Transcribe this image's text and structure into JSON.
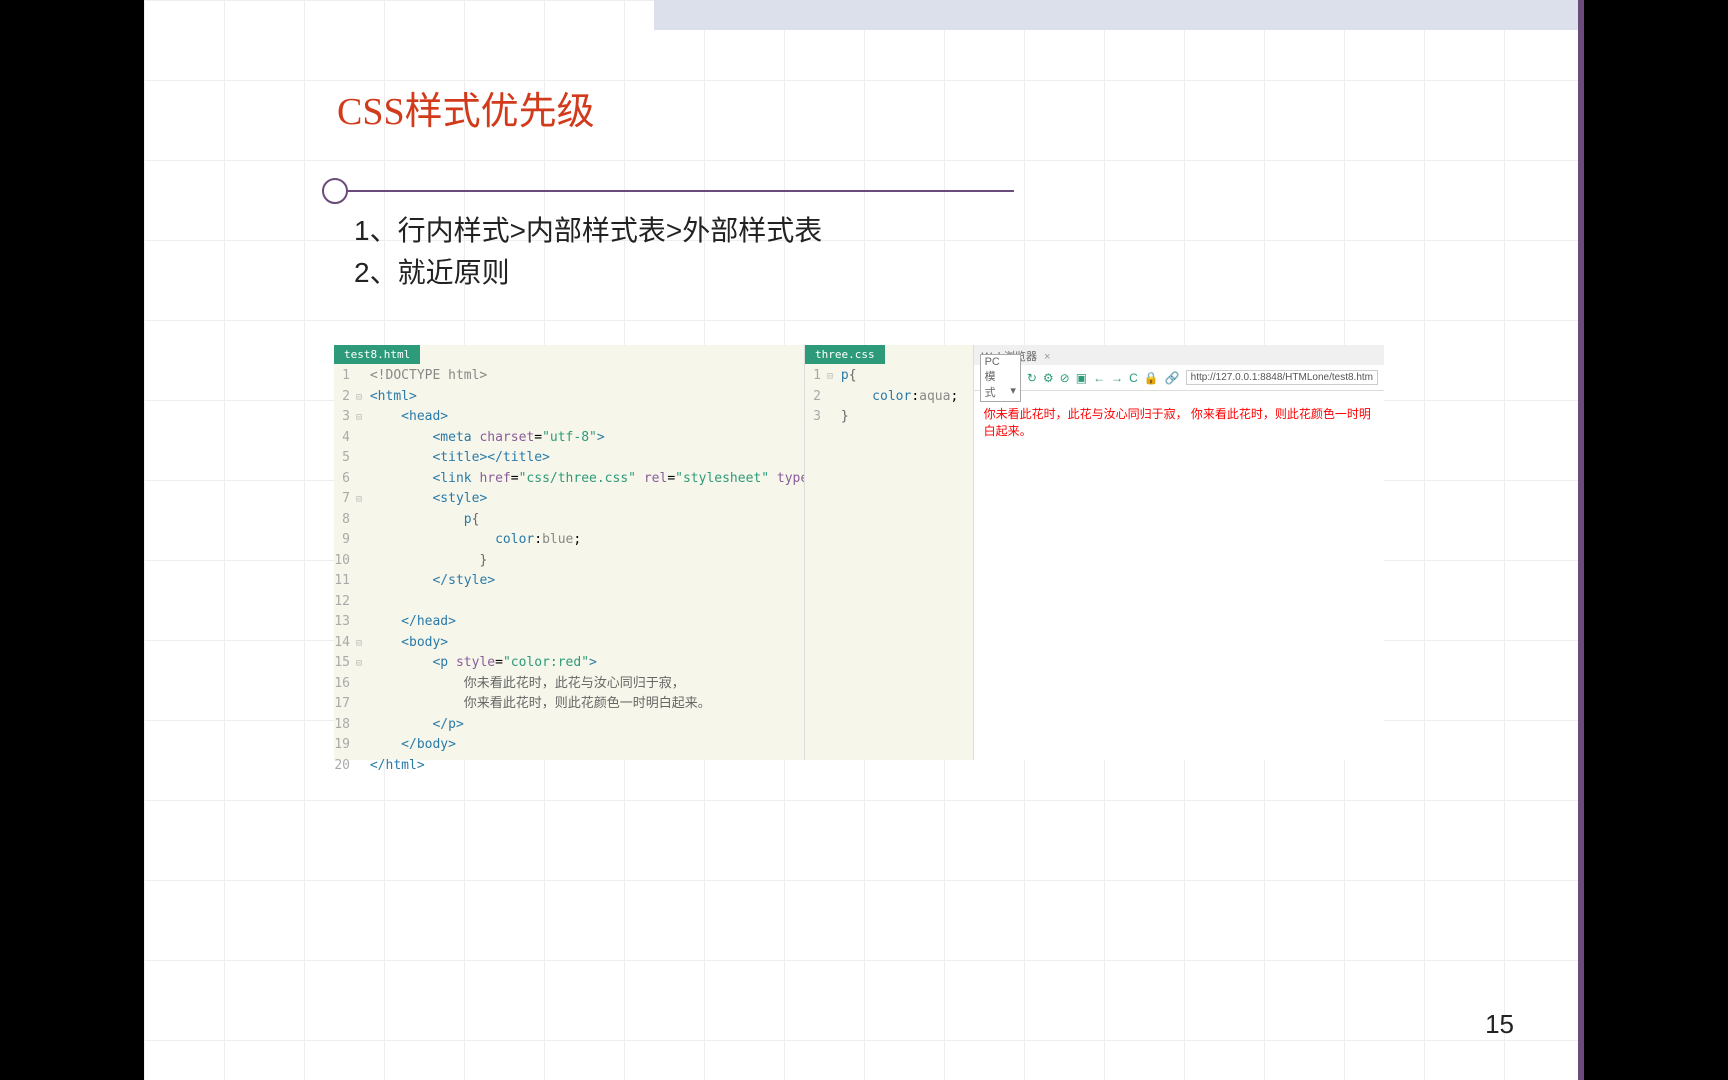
{
  "slide": {
    "title": "CSS样式优先级",
    "bullets": [
      "1、行内样式>内部样式表>外部样式表",
      "2、就近原则"
    ],
    "page_number": "15"
  },
  "editor_html": {
    "tab": "test8.html",
    "lines": [
      {
        "n": "1",
        "fold": "",
        "html": "<span class='tok-doctype'>&lt;!DOCTYPE html&gt;</span>"
      },
      {
        "n": "2",
        "fold": "⊟",
        "html": "<span class='tok-tag'>&lt;html&gt;</span>"
      },
      {
        "n": "3",
        "fold": "⊟",
        "html": "    <span class='tok-tag'>&lt;head&gt;</span>"
      },
      {
        "n": "4",
        "fold": "",
        "html": "        <span class='tok-tag'>&lt;meta</span> <span class='tok-attr-name'>charset</span>=<span class='tok-attr-val'>\"utf-8\"</span><span class='tok-tag'>&gt;</span>"
      },
      {
        "n": "5",
        "fold": "",
        "html": "        <span class='tok-tag'>&lt;title&gt;&lt;/title&gt;</span>"
      },
      {
        "n": "6",
        "fold": "",
        "html": "        <span class='tok-tag'>&lt;link</span> <span class='tok-attr-name'>href</span>=<span class='tok-attr-val'>\"css/three.css\"</span> <span class='tok-attr-name'>rel</span>=<span class='tok-attr-val'>\"stylesheet\"</span> <span class='tok-attr-name'>type</span>=<span class='tok-attr-val'>\"text/css\"</span>"
      },
      {
        "n": "7",
        "fold": "⊟",
        "html": "        <span class='tok-tag'>&lt;style&gt;</span>"
      },
      {
        "n": "8",
        "fold": "",
        "html": "            <span class='tok-tag'>p</span><span class='tok-brace'>{</span>"
      },
      {
        "n": "9",
        "fold": "",
        "html": "                <span class='tok-css-prop'>color</span>:<span class='tok-css-val'>blue</span>;"
      },
      {
        "n": "10",
        "fold": "",
        "html": "              <span class='tok-brace'>}</span>"
      },
      {
        "n": "11",
        "fold": "",
        "html": "        <span class='tok-tag'>&lt;/style&gt;</span>"
      },
      {
        "n": "12",
        "fold": "",
        "html": ""
      },
      {
        "n": "13",
        "fold": "",
        "html": "    <span class='tok-tag'>&lt;/head&gt;</span>"
      },
      {
        "n": "14",
        "fold": "⊟",
        "html": "    <span class='tok-tag'>&lt;body&gt;</span>"
      },
      {
        "n": "15",
        "fold": "⊟",
        "html": "        <span class='tok-tag'>&lt;p</span> <span class='tok-attr-name'>style</span>=<span class='tok-attr-val'>\"color:red\"</span><span class='tok-tag'>&gt;</span>"
      },
      {
        "n": "16",
        "fold": "",
        "html": "            <span class='tok-text'>你未看此花时，此花与汝心同归于寂，</span>"
      },
      {
        "n": "17",
        "fold": "",
        "html": "            <span class='tok-text'>你来看此花时，则此花颜色一时明白起来。</span>"
      },
      {
        "n": "18",
        "fold": "",
        "html": "        <span class='tok-tag'>&lt;/p&gt;</span>"
      },
      {
        "n": "19",
        "fold": "",
        "html": "    <span class='tok-tag'>&lt;/body&gt;</span>"
      },
      {
        "n": "20",
        "fold": "",
        "html": "<span class='tok-tag'>&lt;/html&gt;</span>"
      }
    ]
  },
  "editor_css": {
    "tab": "three.css",
    "lines": [
      {
        "n": "1",
        "fold": "⊟",
        "html": "<span class='tok-tag'>p</span><span class='tok-brace'>{</span>"
      },
      {
        "n": "2",
        "fold": "",
        "html": "    <span class='tok-css-prop'>color</span>:<span class='tok-css-val'>aqua</span>;"
      },
      {
        "n": "3",
        "fold": "",
        "html": "<span class='tok-brace'>}</span>"
      }
    ]
  },
  "browser": {
    "title": "Web浏览器",
    "close": "×",
    "mode": "PC模式",
    "url": "http://127.0.0.1:8848/HTMLone/test8.htm",
    "body_text": "你未看此花时，此花与汝心同归于寂， 你来看此花时，则此花颜色一时明白起来。",
    "icons": {
      "refresh": "↻",
      "gear": "⚙",
      "stop": "⊘",
      "layout": "▣",
      "back": "←",
      "forward": "→",
      "reload": "C",
      "lock": "🔒",
      "link": "🔗"
    }
  }
}
